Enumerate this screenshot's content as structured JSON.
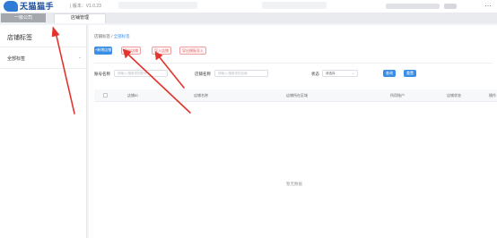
{
  "header": {
    "logo_text": "天猫猫手",
    "logo_sub": "TIANMAO MAOSHOU",
    "version": "| 版本：V1.0.23",
    "more_icon": "more-dots-icon"
  },
  "tabs": [
    {
      "label": "一级公司",
      "active": false
    },
    {
      "label": "店铺管理",
      "active": true
    }
  ],
  "sidebar": {
    "title": "店铺标签",
    "items": [
      {
        "label": "全部标签",
        "icon": "chevron-down-icon"
      }
    ]
  },
  "main": {
    "breadcrumb": {
      "parent": "店铺标签 / ",
      "current": "全部标签"
    },
    "actions": {
      "add": "+新增店铺",
      "export": "导出店铺",
      "import": "导入店铺",
      "download_template": "导出模板导入"
    },
    "filters": {
      "account_label": "账号名称",
      "account_placeholder": "请输入/搜索您的账号",
      "store_label": "店铺名称",
      "store_placeholder": "请输入/搜索您的店铺",
      "status_label": "状态",
      "status_value": "请选择",
      "query_btn": "查询",
      "reset_btn": "重置"
    },
    "table": {
      "columns": [
        "店铺ID",
        "店铺名称",
        "店铺所在区域",
        "所用账户",
        "店铺状态",
        "操作"
      ],
      "empty_text": "暂无数据"
    }
  },
  "colors": {
    "primary": "#3a8ee6",
    "danger_border": "#f29b9b",
    "annotation": "#e2332c"
  }
}
